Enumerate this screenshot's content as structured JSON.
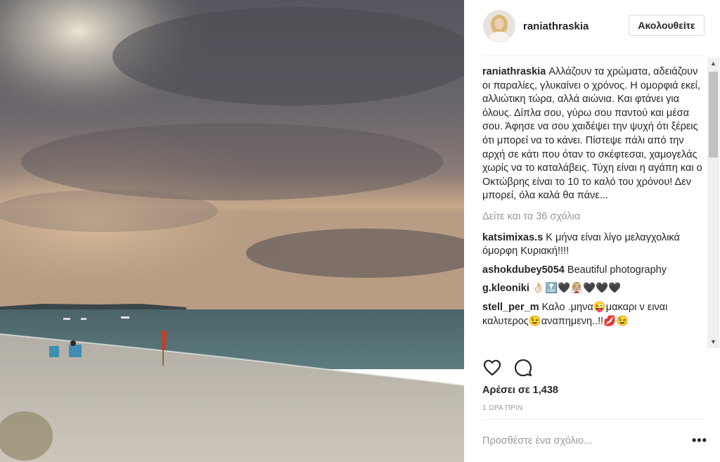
{
  "post": {
    "username": "raniathraskia",
    "follow_label": "Ακολουθείτε",
    "caption_username": "raniathraskia",
    "caption_text": "Αλλάζουν τα χρώματα, αδειάζουν οι παραλίες, γλυκαίνει ο χρόνος. Η ομορφιά εκεί, αλλιώτικη τώρα, αλλά αιώνια. Και φτάνει για όλους. Δίπλα σου, γύρω σου παντού και μέσα σου. Άφησε να σου χαιδέψει την ψυχή ότι ξέρεις ότι μπορεί να το κάνει. Πίστεψε πάλι από την αρχή σε κάτι που όταν το σκέφτεσαι, χαμογελάς χωρίς να το καταλάβεις. Τύχη είναι η αγάπη και ο Οκτώβρης είναι το 10 το καλό του χρόνου! Δεν μπορεί, όλα καλά θα πάνε...",
    "view_all_comments": "Δείτε και τα 36 σχόλια",
    "comments": [
      {
        "user": "katsimixas.s",
        "text": "Κ μήνα είναι λίγο μελαγχολικά όμορφη Κυριακή!!!!"
      },
      {
        "user": "ashokdubey5054",
        "text": "Beautiful photography"
      },
      {
        "user": "g.kleoniki",
        "text": "👌🏻🔝🖤👰🏼🖤🖤🖤"
      },
      {
        "user": "stell_per_m",
        "text": "Καλο .μηνα😜μακαρι ν ειναι καλυτερος😉αναπημενη..!!💋😉"
      }
    ],
    "likes": "Αρέσει σε 1,438",
    "timestamp": "1 ΩΡΑ ΠΡΙΝ",
    "comment_placeholder": "Προσθέστε ένα σχόλιο...",
    "more_options": "•••"
  },
  "icons": {
    "heart": "heart-icon",
    "comment": "comment-bubble-icon",
    "scroll_up": "▲",
    "scroll_down": "▼"
  },
  "colors": {
    "link_grey": "#999999",
    "text": "#262626",
    "border": "#dbdbdb"
  }
}
